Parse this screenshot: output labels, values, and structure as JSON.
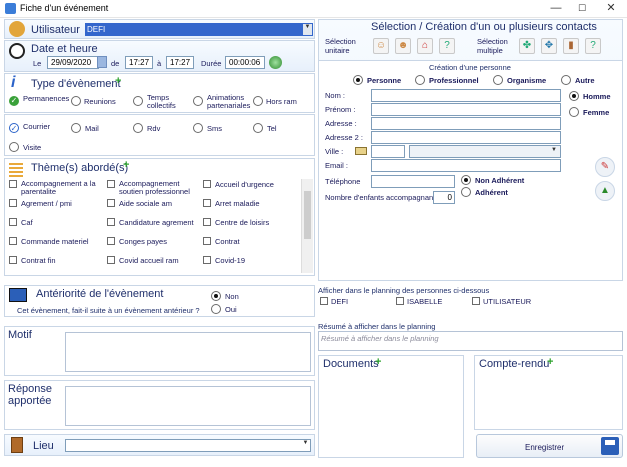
{
  "window": {
    "title": "Fiche d'un événement",
    "min": "—",
    "max": "☐",
    "close": "✕"
  },
  "user": {
    "label": "Utilisateur",
    "value": "DEFI"
  },
  "datetime": {
    "label": "Date et heure",
    "le": "Le",
    "date": "29/09/2020",
    "de": "de",
    "from": "17:27",
    "a": "à",
    "to": "17:27",
    "duree_label": "Durée",
    "duree": "00:00:06"
  },
  "event_type": {
    "label": "Type d'évènement",
    "row1": [
      "Permanences",
      "Reunions",
      "Temps collectifs",
      "Animations partenariales",
      "Hors ram"
    ],
    "row1_selected": 0,
    "row2": [
      "Courrier",
      "Mail",
      "Rdv",
      "Sms",
      "Tel",
      "Visite"
    ],
    "row2_selected": 0
  },
  "themes": {
    "label": "Thème(s) abordé(s)",
    "items": [
      "Accompagnement a la parentalite",
      "Accompagnement soutien professionnel",
      "Accueil d'urgence",
      "Agrement / pmi",
      "Aide sociale am",
      "Arret maladie",
      "Caf",
      "Candidature agrement",
      "Centre de loisirs",
      "Commande materiel",
      "Conges payes",
      "Contrat",
      "Contrat fin",
      "Covid accueil ram",
      "Covid-19"
    ]
  },
  "anteriority": {
    "label": "Antériorité de l'évènement",
    "question": "Cet évènement, fait-il suite  à un évènement antérieur ?",
    "non": "Non",
    "oui": "Oui",
    "selected": "non"
  },
  "motif": {
    "label": "Motif",
    "value": ""
  },
  "reponse": {
    "label": "Réponse apportée",
    "value": ""
  },
  "lieu": {
    "label": "Lieu",
    "value": ""
  },
  "contacts": {
    "title": "Sélection / Création d'un ou plusieurs contacts",
    "unitaire": "Sélection unitaire",
    "multiple": "Sélection multiple",
    "creation_title": "Création d'une personne",
    "types": [
      "Personne",
      "Professionnel",
      "Organisme",
      "Autre"
    ],
    "type_selected": 0,
    "fields": [
      "Nom :",
      "Prénom :",
      "Adresse :",
      "Adresse 2 :",
      "Ville :",
      "Email :",
      "Téléphone"
    ],
    "gender": [
      "Homme",
      "Femme"
    ],
    "gender_selected": 0,
    "membership": [
      "Non Adhérent",
      "Adhérent"
    ],
    "membership_selected": 0,
    "children_label": "Nombre d'enfants accompagnant :",
    "children": "0"
  },
  "planning": {
    "label": "Afficher dans le planning des personnes ci-dessous",
    "people": [
      "DEFI",
      "ISABELLE",
      "UTILISATEUR"
    ]
  },
  "resume": {
    "label": "Résumé à afficher dans le planning",
    "placeholder": "Résumé à afficher dans le planning"
  },
  "documents": {
    "label": "Documents"
  },
  "compte_rendu": {
    "label": "Compte-rendu"
  },
  "save": {
    "label": "Enregistrer"
  },
  "colors": {
    "accent": "#1f2f6b",
    "selection": "#3366cc",
    "green": "#2ea32e"
  }
}
